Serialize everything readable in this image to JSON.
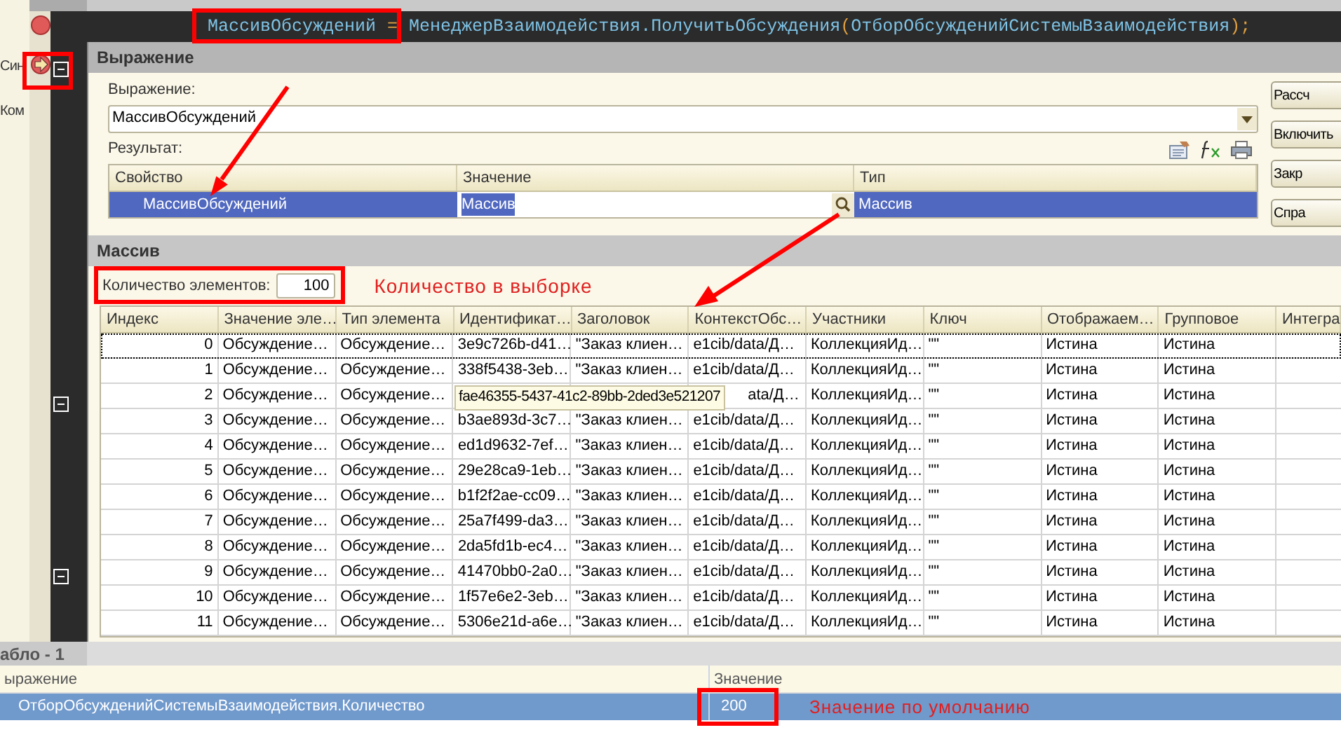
{
  "background_form": {
    "labels": [
      "Син",
      "Ком"
    ]
  },
  "code_editor": {
    "tokens": [
      {
        "text": "МассивОбсуждений",
        "kind": "identifier"
      },
      {
        "text": "=",
        "kind": "operator"
      },
      {
        "text": "МенеджерВзаимодействия.ПолучитьОбсуждения",
        "kind": "identifier"
      },
      {
        "text": "(",
        "kind": "operator"
      },
      {
        "text": "ОтборОбсужденийСистемыВзаимодействия",
        "kind": "identifier"
      },
      {
        "text": ");",
        "kind": "operator"
      }
    ],
    "gutter_markers": [
      {
        "kind": "breakpoint"
      },
      {
        "kind": "current"
      }
    ]
  },
  "expression_window": {
    "title": "Выражение",
    "field_label": "Выражение:",
    "field_value": "МассивОбсуждений",
    "result_label": "Результат:",
    "buttons": [
      "Рассч",
      "Включить",
      "Закр",
      "Спра"
    ],
    "table": {
      "columns": [
        "Свойство",
        "Значение",
        "Тип"
      ],
      "rows": [
        {
          "cells": [
            "МассивОбсуждений",
            "Массив",
            "Массив"
          ],
          "selected": true
        }
      ]
    }
  },
  "array_window": {
    "title": "Массив",
    "count_label": "Количество элементов:",
    "count_value": "100",
    "table": {
      "columns": [
        "Индекс",
        "Значение эле…",
        "Тип элемента",
        "Идентификат…",
        "Заголовок",
        "КонтекстОбс…",
        "Участники",
        "Ключ",
        "Отображаем…",
        "Групповое",
        "Интегра"
      ],
      "rows": [
        {
          "cells": [
            "0",
            "Обсуждение…",
            "Обсуждение…",
            "3e9c726b-d41…",
            "\"Заказ клиен…",
            "e1cib/data/Д…",
            "КоллекцияИд…",
            "\"\"",
            "Истина",
            "Истина"
          ],
          "focused": true
        },
        {
          "cells": [
            "1",
            "Обсуждение…",
            "Обсуждение…",
            "338f5438-3eb…",
            "\"Заказ клиен…",
            "e1cib/data/Д…",
            "КоллекцияИд…",
            "\"\"",
            "Истина",
            "Истина"
          ],
          "focused": false
        },
        {
          "cells": [
            "2",
            "Обсуждение…",
            "Обсуждение…",
            null,
            null,
            "ata/Д…",
            "КоллекцияИд…",
            "\"\"",
            "Истина",
            "Истина"
          ],
          "focused": false
        },
        {
          "cells": [
            "3",
            "Обсуждение…",
            "Обсуждение…",
            "b3ae893d-3c7…",
            "\"Заказ клиен…",
            "e1cib/data/Д…",
            "КоллекцияИд…",
            "\"\"",
            "Истина",
            "Истина"
          ],
          "focused": false
        },
        {
          "cells": [
            "4",
            "Обсуждение…",
            "Обсуждение…",
            "ed1d9632-7ef…",
            "\"Заказ клиен…",
            "e1cib/data/Д…",
            "КоллекцияИд…",
            "\"\"",
            "Истина",
            "Истина"
          ],
          "focused": false
        },
        {
          "cells": [
            "5",
            "Обсуждение…",
            "Обсуждение…",
            "29e28ca9-1eb…",
            "\"Заказ клиен…",
            "e1cib/data/Д…",
            "КоллекцияИд…",
            "\"\"",
            "Истина",
            "Истина"
          ],
          "focused": false
        },
        {
          "cells": [
            "6",
            "Обсуждение…",
            "Обсуждение…",
            "b1f2f2ae-cc09…",
            "\"Заказ клиен…",
            "e1cib/data/Д…",
            "КоллекцияИд…",
            "\"\"",
            "Истина",
            "Истина"
          ],
          "focused": false
        },
        {
          "cells": [
            "7",
            "Обсуждение…",
            "Обсуждение…",
            "25a7f499-da3…",
            "\"Заказ клиен…",
            "e1cib/data/Д…",
            "КоллекцияИд…",
            "\"\"",
            "Истина",
            "Истина"
          ],
          "focused": false
        },
        {
          "cells": [
            "8",
            "Обсуждение…",
            "Обсуждение…",
            "2da5fd1b-ec4…",
            "\"Заказ клиен…",
            "e1cib/data/Д…",
            "КоллекцияИд…",
            "\"\"",
            "Истина",
            "Истина"
          ],
          "focused": false
        },
        {
          "cells": [
            "9",
            "Обсуждение…",
            "Обсуждение…",
            "41470bb0-2a0…",
            "\"Заказ клиен…",
            "e1cib/data/Д…",
            "КоллекцияИд…",
            "\"\"",
            "Истина",
            "Истина"
          ],
          "focused": false
        },
        {
          "cells": [
            "10",
            "Обсуждение…",
            "Обсуждение…",
            "1f57e6e2-3eb…",
            "\"Заказ клиен…",
            "e1cib/data/Д…",
            "КоллекцияИд…",
            "\"\"",
            "Истина",
            "Истина"
          ],
          "focused": false
        },
        {
          "cells": [
            "11",
            "Обсуждение…",
            "Обсуждение…",
            "5306e21d-a6e…",
            "\"Заказ клиен…",
            "e1cib/data/Д…",
            "КоллекцияИд…",
            "\"\"",
            "Истина",
            "Истина"
          ],
          "focused": false
        }
      ]
    },
    "tooltip": "fae46355-5437-41c2-89bb-2ded3e521207"
  },
  "bottom_panel": {
    "tab": "абло - 1",
    "columns": [
      "ыражение",
      "Значение"
    ],
    "rows": [
      {
        "cells": [
          "ОтборОбсужденийСистемыВзаимодействия.Количество",
          "200"
        ],
        "selected": true
      }
    ]
  },
  "annotations": {
    "count_note": "Количество в выборке",
    "default_note": "Значение по умолчанию"
  }
}
